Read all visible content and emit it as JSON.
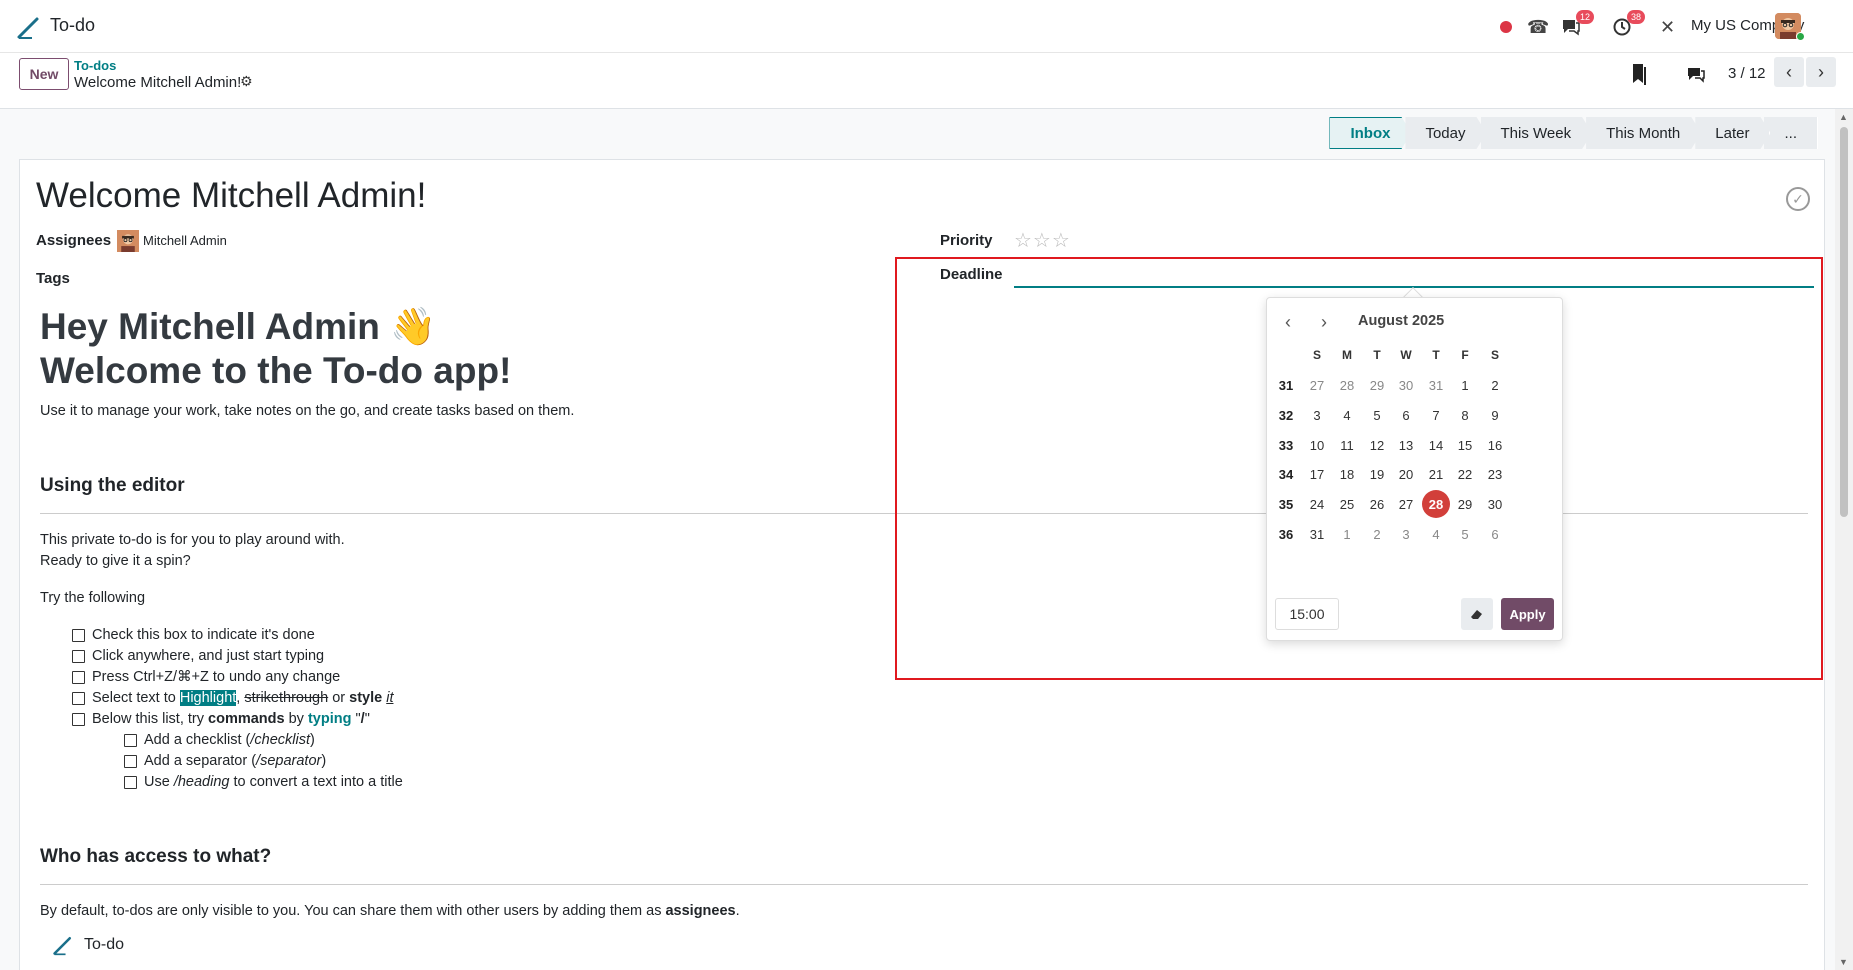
{
  "app": {
    "name": "To-do",
    "company": "My US Company"
  },
  "systray": {
    "messages_count": "12",
    "activities_count": "38"
  },
  "control": {
    "new_label": "New",
    "breadcrumb_parent": "To-dos",
    "breadcrumb_current": "Welcome Mitchell Admin!",
    "pager": "3 / 12"
  },
  "stages": [
    "Inbox",
    "Today",
    "This Week",
    "This Month",
    "Later",
    "..."
  ],
  "record": {
    "title": "Welcome Mitchell Admin!",
    "assignees_label": "Assignees",
    "assignee": "Mitchell Admin",
    "tags_label": "Tags",
    "priority_label": "Priority",
    "deadline_label": "Deadline",
    "priority_stars": 0
  },
  "body": {
    "heading1": "Hey Mitchell Admin 👋",
    "heading2": "Welcome to the To-do app!",
    "intro": "Use it to manage your work, take notes on the go, and create tasks based on them.",
    "section1_title": "Using the editor",
    "section1_p1": "This private to-do is for you to play around with.",
    "section1_p2": "Ready to give it a spin?",
    "try_label": "Try the following",
    "check1": "Check this box to indicate it's done",
    "check2": "Click anywhere, and just start typing",
    "check3": "Press Ctrl+Z/⌘+Z to undo any change",
    "check4_a": "Select text to ",
    "check4_highlight": "Highlight",
    "check4_b": ", ",
    "check4_strike": "strikethrough",
    "check4_c": " or ",
    "check4_bold": "style",
    "check4_d": " ",
    "check4_italic": "it",
    "check5_a": "Below this list, try ",
    "check5_bold": "commands",
    "check5_b": " by ",
    "check5_teal": "typing",
    "check5_c": " \"",
    "check5_slash": "/",
    "check5_d": "\"",
    "sub1_a": "Add a checklist (",
    "sub1_i": "/checklist",
    "sub1_b": ")",
    "sub2_a": "Add a separator (",
    "sub2_i": "/separator",
    "sub2_b": ")",
    "sub3_a": "Use ",
    "sub3_i": "/heading",
    "sub3_b": " to convert a text into a title",
    "section2_title": "Who has access to what?",
    "section2_p_a": "By default, to-dos are only visible to you. You can share them with other users by adding them as ",
    "section2_p_bold": "assignees",
    "section2_p_b": ".",
    "footer_app": "To-do"
  },
  "datepicker": {
    "month": "August 2025",
    "weekdays": [
      "S",
      "M",
      "T",
      "W",
      "T",
      "F",
      "S"
    ],
    "weeks": [
      {
        "wk": "31",
        "days": [
          "27",
          "28",
          "29",
          "30",
          "31",
          "1",
          "2"
        ],
        "dim": [
          true,
          true,
          true,
          true,
          true,
          false,
          false
        ]
      },
      {
        "wk": "32",
        "days": [
          "3",
          "4",
          "5",
          "6",
          "7",
          "8",
          "9"
        ],
        "dim": [
          false,
          false,
          false,
          false,
          false,
          false,
          false
        ]
      },
      {
        "wk": "33",
        "days": [
          "10",
          "11",
          "12",
          "13",
          "14",
          "15",
          "16"
        ],
        "dim": [
          false,
          false,
          false,
          false,
          false,
          false,
          false
        ]
      },
      {
        "wk": "34",
        "days": [
          "17",
          "18",
          "19",
          "20",
          "21",
          "22",
          "23"
        ],
        "dim": [
          false,
          false,
          false,
          false,
          false,
          false,
          false
        ]
      },
      {
        "wk": "35",
        "days": [
          "24",
          "25",
          "26",
          "27",
          "28",
          "29",
          "30"
        ],
        "dim": [
          false,
          false,
          false,
          false,
          false,
          false,
          false
        ]
      },
      {
        "wk": "36",
        "days": [
          "31",
          "1",
          "2",
          "3",
          "4",
          "5",
          "6"
        ],
        "dim": [
          false,
          true,
          true,
          true,
          true,
          true,
          true
        ]
      }
    ],
    "selected_day": "28",
    "time": "15:00",
    "apply_label": "Apply"
  },
  "colors": {
    "brand": "#714B67",
    "accent": "#017e84",
    "selected": "#d23f3a",
    "highlight_box": "#e0191f"
  }
}
